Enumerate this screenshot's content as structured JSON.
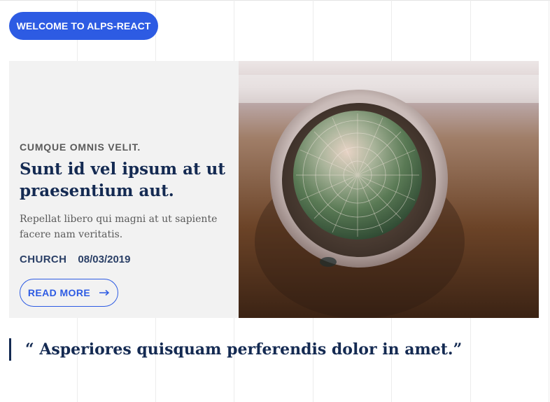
{
  "header": {
    "welcome_label": "WELCOME TO ALPS-REACT"
  },
  "feature": {
    "kicker": "CUMQUE OMNIS VELIT.",
    "title": "Sunt id vel ipsum at ut praesentium aut.",
    "excerpt": "Repellat libero qui magni at ut sapiente facere nam veritatis.",
    "category": "CHURCH",
    "date": "08/03/2019",
    "read_more_label": "READ MORE",
    "image_alt": "Potted cactus viewed from above"
  },
  "quote": {
    "text": "“ Asperiores quisquam perferendis dolor in amet.”"
  },
  "colors": {
    "accent": "#2d5be3",
    "heading": "#142a52",
    "card_bg": "#f2f2f2"
  },
  "icons": {
    "read_more": "arrow-right-icon"
  }
}
